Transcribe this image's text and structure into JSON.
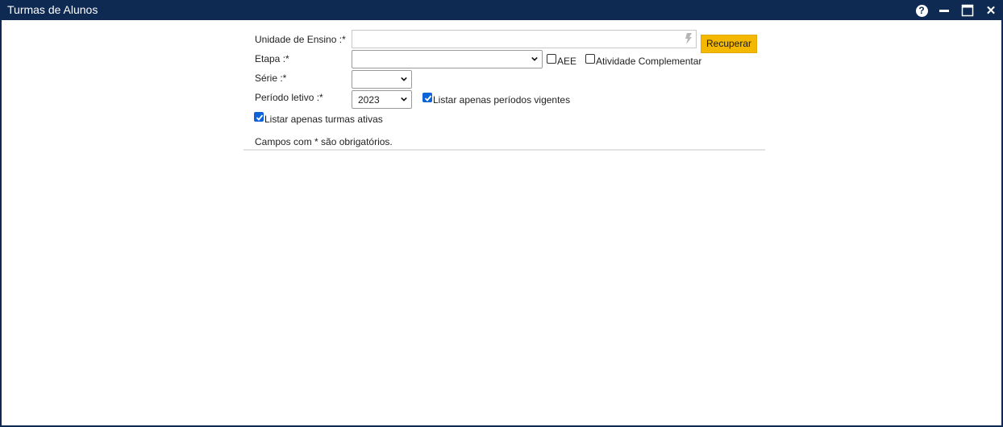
{
  "window": {
    "title": "Turmas de Alunos",
    "controls": {
      "help": "?",
      "close": "✕"
    },
    "colors": {
      "titlebar": "#0e2a52",
      "accent_button": "#f5b800",
      "checkbox_checked": "#0d63d8"
    }
  },
  "form": {
    "unidade_label": "Unidade de Ensino :*",
    "unidade_value": "",
    "recuperar_label": "Recuperar",
    "etapa_label": "Etapa :*",
    "etapa_value": "",
    "aee_label": "AEE",
    "aee_checked": false,
    "atividade_label": "Atividade Complementar",
    "atividade_checked": false,
    "serie_label": "Série :*",
    "serie_value": "",
    "periodo_label": "Período letivo :*",
    "periodo_value": "2023",
    "vigentes_label": "Listar apenas períodos vigentes",
    "vigentes_checked": true,
    "turmas_ativas_label": "Listar apenas turmas ativas",
    "turmas_ativas_checked": true,
    "required_note": "Campos com * são obrigatórios."
  }
}
